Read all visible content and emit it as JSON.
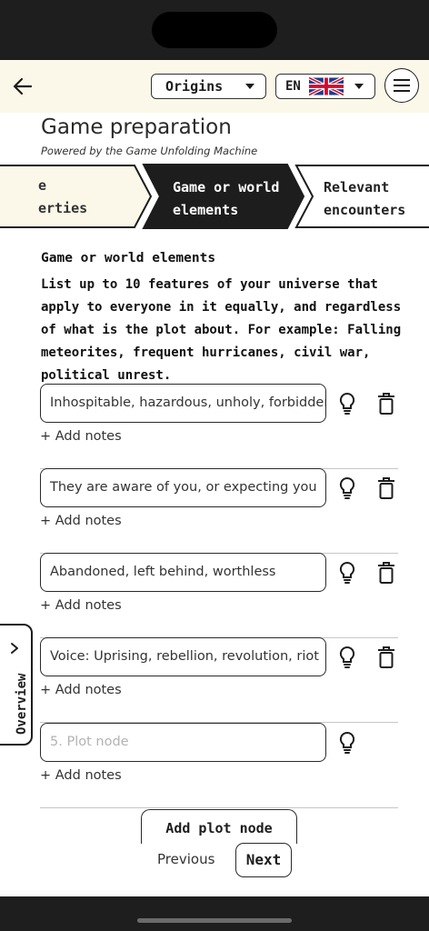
{
  "header": {
    "story_select": "Origins",
    "language_select": "EN",
    "flag": "uk-flag-icon",
    "back_icon": "back-arrow-icon",
    "menu_icon": "hamburger-menu-icon"
  },
  "page": {
    "title": "Game preparation",
    "subtitle": "Powered by the Game Unfolding Machine"
  },
  "steps": {
    "previous": {
      "line1": "e",
      "line2": "erties"
    },
    "current": {
      "line1": "Game or world",
      "line2": "elements"
    },
    "next": {
      "line1": "Relevant",
      "line2": "encounters"
    }
  },
  "section": {
    "title": "Game or world elements",
    "description": "List up to 10 features of your universe that apply to everyone in it equally, and regardless of what is the plot about. For example: Falling meteorites, frequent hurricanes, civil war, political unrest."
  },
  "items": [
    {
      "value": "Inhospitable, hazardous, unholy, forbidden",
      "placeholder": "",
      "add_notes": "+ Add notes",
      "deletable": true
    },
    {
      "value": "They are aware of you, or expecting you",
      "placeholder": "",
      "add_notes": "+ Add notes",
      "deletable": true
    },
    {
      "value": "Abandoned, left behind, worthless",
      "placeholder": "",
      "add_notes": "+ Add notes",
      "deletable": true
    },
    {
      "value": "Voice: Uprising, rebellion, revolution, riot",
      "placeholder": "",
      "add_notes": "+ Add notes",
      "deletable": true
    },
    {
      "value": "",
      "placeholder": "5. Plot node",
      "add_notes": "+ Add notes",
      "deletable": false
    }
  ],
  "overview_tab": {
    "label": "Overview"
  },
  "footer": {
    "add_plot_node": "Add plot node",
    "previous": "Previous",
    "next": "Next"
  },
  "colors": {
    "appbar_bg": "#fbf8e9",
    "step_current_bg": "#1d1d1d",
    "step_previous_bg": "#fbf8e9",
    "text": "#1d1d1d"
  }
}
